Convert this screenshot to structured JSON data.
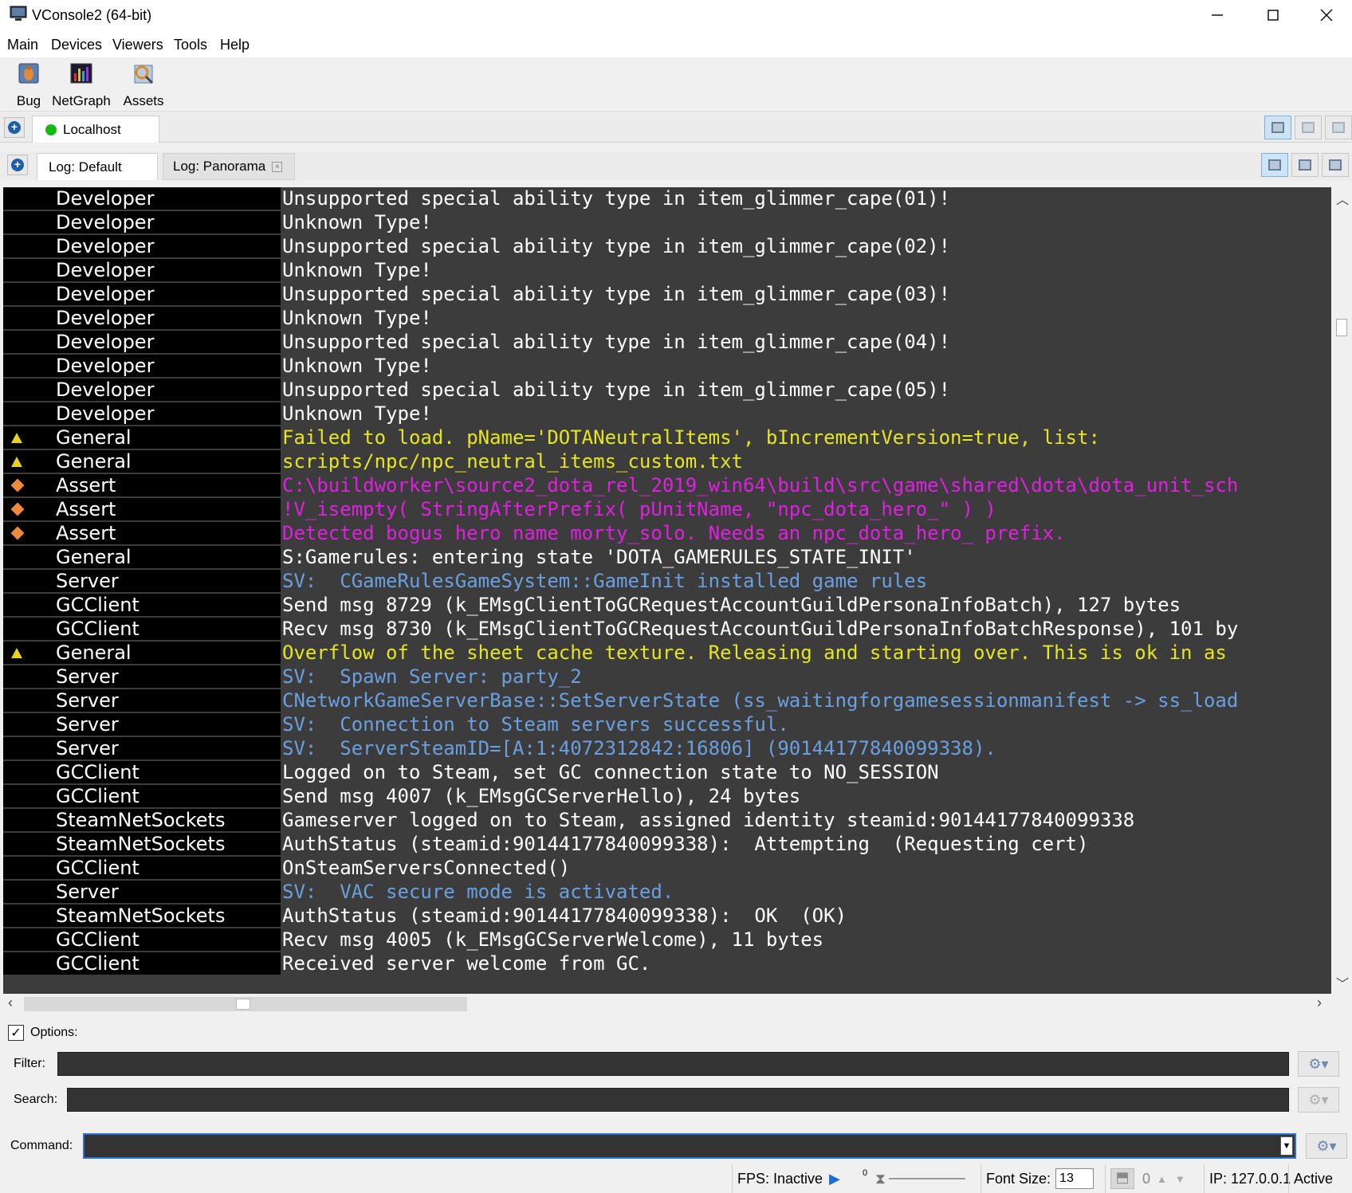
{
  "window": {
    "title": "VConsole2 (64-bit)"
  },
  "menu": [
    "Main",
    "Devices",
    "Viewers",
    "Tools",
    "Help"
  ],
  "toolbar": [
    {
      "label": "Bug",
      "icon": "bug-icon"
    },
    {
      "label": "NetGraph",
      "icon": "netgraph-icon"
    },
    {
      "label": "Assets",
      "icon": "assets-icon"
    }
  ],
  "devices": {
    "tab": "Localhost",
    "status_color": "#16b816"
  },
  "log_tabs": [
    "Log: Default",
    "Log: Panorama"
  ],
  "colors": {
    "default": "#ffffff",
    "warning": "#e6e620",
    "assert": "#e020e0",
    "server": "#6aa0e0",
    "console_bg": "#3c3c3c",
    "channel_bg": "#000000"
  },
  "log_rows": [
    {
      "channel": "Developer",
      "severity": "",
      "color": "#ffffff",
      "text": "Unsupported special ability type in item_glimmer_cape(01)!"
    },
    {
      "channel": "Developer",
      "severity": "",
      "color": "#ffffff",
      "text": "Unknown Type!"
    },
    {
      "channel": "Developer",
      "severity": "",
      "color": "#ffffff",
      "text": "Unsupported special ability type in item_glimmer_cape(02)!"
    },
    {
      "channel": "Developer",
      "severity": "",
      "color": "#ffffff",
      "text": "Unknown Type!"
    },
    {
      "channel": "Developer",
      "severity": "",
      "color": "#ffffff",
      "text": "Unsupported special ability type in item_glimmer_cape(03)!"
    },
    {
      "channel": "Developer",
      "severity": "",
      "color": "#ffffff",
      "text": "Unknown Type!"
    },
    {
      "channel": "Developer",
      "severity": "",
      "color": "#ffffff",
      "text": "Unsupported special ability type in item_glimmer_cape(04)!"
    },
    {
      "channel": "Developer",
      "severity": "",
      "color": "#ffffff",
      "text": "Unknown Type!"
    },
    {
      "channel": "Developer",
      "severity": "",
      "color": "#ffffff",
      "text": "Unsupported special ability type in item_glimmer_cape(05)!"
    },
    {
      "channel": "Developer",
      "severity": "",
      "color": "#ffffff",
      "text": "Unknown Type!"
    },
    {
      "channel": "General",
      "severity": "warn",
      "color": "#e6e620",
      "text": "Failed to load. pName='DOTANeutralItems', bIncrementVersion=true, list:"
    },
    {
      "channel": "General",
      "severity": "warn",
      "color": "#e6e620",
      "text": "scripts/npc/npc_neutral_items_custom.txt"
    },
    {
      "channel": "Assert",
      "severity": "assert",
      "color": "#e020e0",
      "text": "C:\\buildworker\\source2_dota_rel_2019_win64\\build\\src\\game\\shared\\dota\\dota_unit_sch"
    },
    {
      "channel": "Assert",
      "severity": "assert",
      "color": "#e020e0",
      "text": "!V_isempty( StringAfterPrefix( pUnitName, \"npc_dota_hero_\" ) )"
    },
    {
      "channel": "Assert",
      "severity": "assert",
      "color": "#e020e0",
      "text": "Detected bogus hero name morty_solo. Needs an npc_dota_hero_ prefix."
    },
    {
      "channel": "General",
      "severity": "",
      "color": "#ffffff",
      "text": "S:Gamerules: entering state 'DOTA_GAMERULES_STATE_INIT'"
    },
    {
      "channel": "Server",
      "severity": "",
      "color": "#6aa0e0",
      "text": "SV:  CGameRulesGameSystem::GameInit installed game rules"
    },
    {
      "channel": "GCClient",
      "severity": "",
      "color": "#ffffff",
      "text": "Send msg 8729 (k_EMsgClientToGCRequestAccountGuildPersonaInfoBatch), 127 bytes"
    },
    {
      "channel": "GCClient",
      "severity": "",
      "color": "#ffffff",
      "text": "Recv msg 8730 (k_EMsgClientToGCRequestAccountGuildPersonaInfoBatchResponse), 101 by"
    },
    {
      "channel": "General",
      "severity": "warn",
      "color": "#e6e620",
      "text": "Overflow of the sheet cache texture. Releasing and starting over. This is ok in as"
    },
    {
      "channel": "Server",
      "severity": "",
      "color": "#6aa0e0",
      "text": "SV:  Spawn Server: party_2"
    },
    {
      "channel": "Server",
      "severity": "",
      "color": "#6aa0e0",
      "text": "CNetworkGameServerBase::SetServerState (ss_waitingforgamesessionmanifest -> ss_load"
    },
    {
      "channel": "Server",
      "severity": "",
      "color": "#6aa0e0",
      "text": "SV:  Connection to Steam servers successful."
    },
    {
      "channel": "Server",
      "severity": "",
      "color": "#6aa0e0",
      "text": "SV:  ServerSteamID=[A:1:4072312842:16806] (90144177840099338)."
    },
    {
      "channel": "GCClient",
      "severity": "",
      "color": "#ffffff",
      "text": "Logged on to Steam, set GC connection state to NO_SESSION"
    },
    {
      "channel": "GCClient",
      "severity": "",
      "color": "#ffffff",
      "text": "Send msg 4007 (k_EMsgGCServerHello), 24 bytes"
    },
    {
      "channel": "SteamNetSockets",
      "severity": "",
      "color": "#ffffff",
      "text": "Gameserver logged on to Steam, assigned identity steamid:90144177840099338"
    },
    {
      "channel": "SteamNetSockets",
      "severity": "",
      "color": "#ffffff",
      "text": "AuthStatus (steamid:90144177840099338):  Attempting  (Requesting cert)"
    },
    {
      "channel": "GCClient",
      "severity": "",
      "color": "#ffffff",
      "text": "OnSteamServersConnected()"
    },
    {
      "channel": "Server",
      "severity": "",
      "color": "#6aa0e0",
      "text": "SV:  VAC secure mode is activated."
    },
    {
      "channel": "SteamNetSockets",
      "severity": "",
      "color": "#ffffff",
      "text": "AuthStatus (steamid:90144177840099338):  OK  (OK)"
    },
    {
      "channel": "GCClient",
      "severity": "",
      "color": "#ffffff",
      "text": "Recv msg 4005 (k_EMsgGCServerWelcome), 11 bytes"
    },
    {
      "channel": "GCClient",
      "severity": "",
      "color": "#ffffff",
      "text": "Received server welcome from GC."
    }
  ],
  "options": {
    "label": "Options:",
    "checked": true
  },
  "filter": {
    "label": "Filter:",
    "value": ""
  },
  "search": {
    "label": "Search:",
    "value": ""
  },
  "command": {
    "label": "Command:",
    "value": ""
  },
  "status": {
    "fps": "FPS: Inactive",
    "slider_value": "0",
    "font_size_label": "Font Size:",
    "font_size": "13",
    "count": "0",
    "ip": "IP: 127.0.0.1",
    "state": "Active"
  }
}
